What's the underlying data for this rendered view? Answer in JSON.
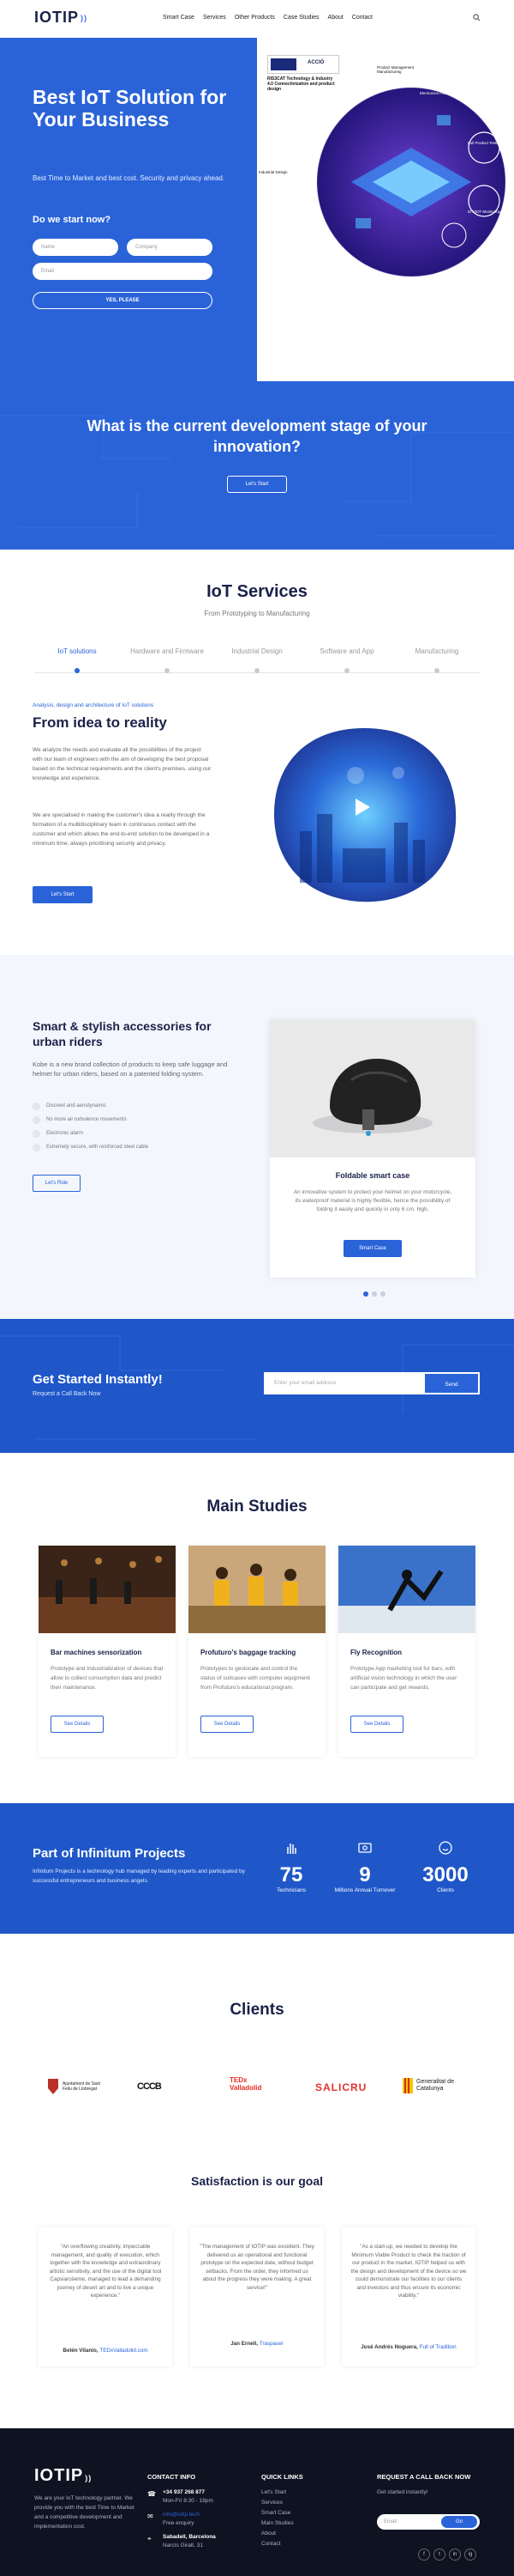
{
  "header": {
    "logo": "IOTIP",
    "nav": [
      "Smart Case",
      "Services",
      "Other Products",
      "Case Studies",
      "About",
      "Contact"
    ]
  },
  "hero": {
    "title": "Best IoT Solution for Your Business",
    "subtitle": "Best Time to Market and best cost. Security and privacy ahead.",
    "question": "Do we start now?",
    "name_placeholder": "Name",
    "company_placeholder": "Company",
    "email_placeholder": "Email",
    "cta": "YES, PLEASE",
    "cert_label": "RIS3CAT Technology & Industry 4.0 Connectivization and product design",
    "cert_mark": "ACCIÓ",
    "chip_labels": [
      "Product Management Manufacturing",
      "Electronics Platform",
      "Industrial Design",
      "Full Product Testing",
      "DIY/IOT Monitoring"
    ]
  },
  "stage": {
    "title": "What is the current development stage of your innovation?",
    "button": "Let's Start"
  },
  "services": {
    "title": "IoT Services",
    "subtitle": "From Prototyping to Manufacturing",
    "tabs": [
      "IoT solutions",
      "Hardware and Firmware",
      "Industrial Design",
      "Software and App",
      "Manufacturing"
    ],
    "kicker": "Analysis, design and architecture of IoT solutions",
    "heading": "From idea to reality",
    "para1": "We analyze the needs and evaluate all the possibilities of the project with our team of engineers with the aim of developing the best proposal based on the technical requirements and the client's premises, using our knowledge and experience.",
    "para2": "We are specialised in making the customer's idea a reality through the formation of a multidisciplinary team in continuous contact with the customer and which allows the end-to-end solution to be developed in a minimum time, always prioritising security and privacy.",
    "button": "Let's Start"
  },
  "accessories": {
    "title": "Smart & stylish accessories for urban riders",
    "desc": "Kobe is a new brand collection of products to keep safe luggage and helmet for urban riders, based on a patented folding system.",
    "features": [
      "Discreet and aerodynamic",
      "No more air turbulence movements",
      "Electronic alarm",
      "Extremely secure, with reinforced steel cable"
    ],
    "button": "Let's Ride",
    "card_title": "Foldable smart case",
    "card_desc": "An innovative system to protect your helmet on your motorcycle, its waterproof material is highly flexible, hence the possibility of folding it easily and quickly in only 6 cm. high.",
    "card_button": "Smart Case"
  },
  "get_started": {
    "title": "Get Started Instantly!",
    "subtitle": "Request a Call Back Now",
    "placeholder": "Enter your email address",
    "button": "Send"
  },
  "studies": {
    "title": "Main Studies",
    "items": [
      {
        "title": "Bar machines sensorization",
        "desc": "Prototype and Industrialization of devices that allow to collect consumption data and predict their maintenance.",
        "button": "See Details"
      },
      {
        "title": "Profuturo's baggage tracking",
        "desc": "Prototypes to geolocate and control the status of suitcases with computer equipment from Profuturo's educational program.",
        "button": "See Details"
      },
      {
        "title": "Fly Recognition",
        "desc": "Prototype App marketing tool for bars, with artificial vision technology in which the user can participate and get rewards.",
        "button": "See Details"
      }
    ]
  },
  "infinitum": {
    "title": "Part of Infinitum Projects",
    "desc": "Infinitum Projects is a technology hub managed by leading experts and participated by successful entrepreneurs and business angels.",
    "stats": [
      {
        "value": "75",
        "label": "Technicians"
      },
      {
        "value": "9",
        "label": "Millions Annual Turnover"
      },
      {
        "value": "3000",
        "label": "Clients"
      }
    ]
  },
  "clients": {
    "title": "Clients",
    "logos": [
      "Ajuntament de Sant Feliu de Llobregat",
      "CCCB",
      "TEDx Valladolid",
      "SALICRU",
      "Generalitat de Catalunya"
    ]
  },
  "satisfaction": {
    "title": "Satisfaction is our goal",
    "testimonials": [
      {
        "quote": "\"An overflowing creativity, impeccable management, and quality of execution, which together with the knowledge and extraordinary artistic sensitivity, and the use of the digital tool Capsiarcéeme, managed to lead a demanding journey of desert art and to live a unique experience.\"",
        "author": "Belén Vilanio,",
        "org": "TEDxValladolid.com"
      },
      {
        "quote": "\"The management of IOTIP was excellent. They delivered us an operational and functional prototype on the expected date, without budget setbacks. From the order, they informed us about the progress they were making. A great service!\"",
        "author": "Jan Ernell,",
        "org": "Traspaser"
      },
      {
        "quote": "\"As a start-up, we needed to develop the Minimum Viable Product to check the traction of our product in the market. IOTIP helped us with the design and development of the device so we could demonstrate our facilities to our clients and investors and thus ensure its economic viability.\"",
        "author": "José Andrés Noguera,",
        "org": "Full of Tradition"
      }
    ]
  },
  "footer": {
    "logo": "IOTIP",
    "about": "We are your IoT technology partner. We provide you with the best Time to Market and a competitive development and implementation cost.",
    "contact_title": "CONTACT INFO",
    "phone": "+34 937 268 877",
    "hours": "Mon-Fri 8:30 - 18pm",
    "email": "info@iotip.tech",
    "email_sub": "Free enquiry",
    "address": "Sabadell, Barcelona",
    "address_sub": "Narcís Giralt, 31",
    "links_title": "QUICK LINKS",
    "links": [
      "Let's Start",
      "Services",
      "Smart Case",
      "Main Studies",
      "About",
      "Contact"
    ],
    "callback_title": "REQUEST A CALL BACK NOW",
    "callback_sub": "Get started instantly!",
    "email_placeholder": "Email",
    "go": "Go",
    "socials": [
      "f",
      "t",
      "in",
      "ig"
    ]
  },
  "colors": {
    "primary": "#2a63d8",
    "dark": "#1a2148",
    "footer": "#0f1220"
  }
}
